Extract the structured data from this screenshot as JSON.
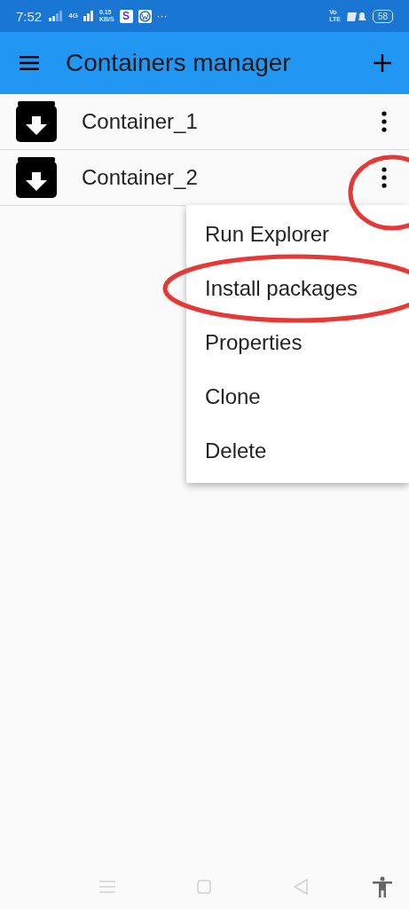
{
  "status_bar": {
    "time": "7:52",
    "network": "4G",
    "speed_value": "0.15",
    "speed_unit": "KB/S",
    "app_badge": "S",
    "more": "···",
    "volte_top": "Vo",
    "volte_bottom": "LTE",
    "battery": "58"
  },
  "app_bar": {
    "title": "Containers manager"
  },
  "containers": [
    {
      "name": "Container_1",
      "circled": false
    },
    {
      "name": "Container_2",
      "circled": true
    }
  ],
  "menu": {
    "items": [
      {
        "label": "Run Explorer",
        "circled": false
      },
      {
        "label": "Install packages",
        "circled": true
      },
      {
        "label": "Properties",
        "circled": false
      },
      {
        "label": "Clone",
        "circled": false
      },
      {
        "label": "Delete",
        "circled": false
      }
    ]
  }
}
